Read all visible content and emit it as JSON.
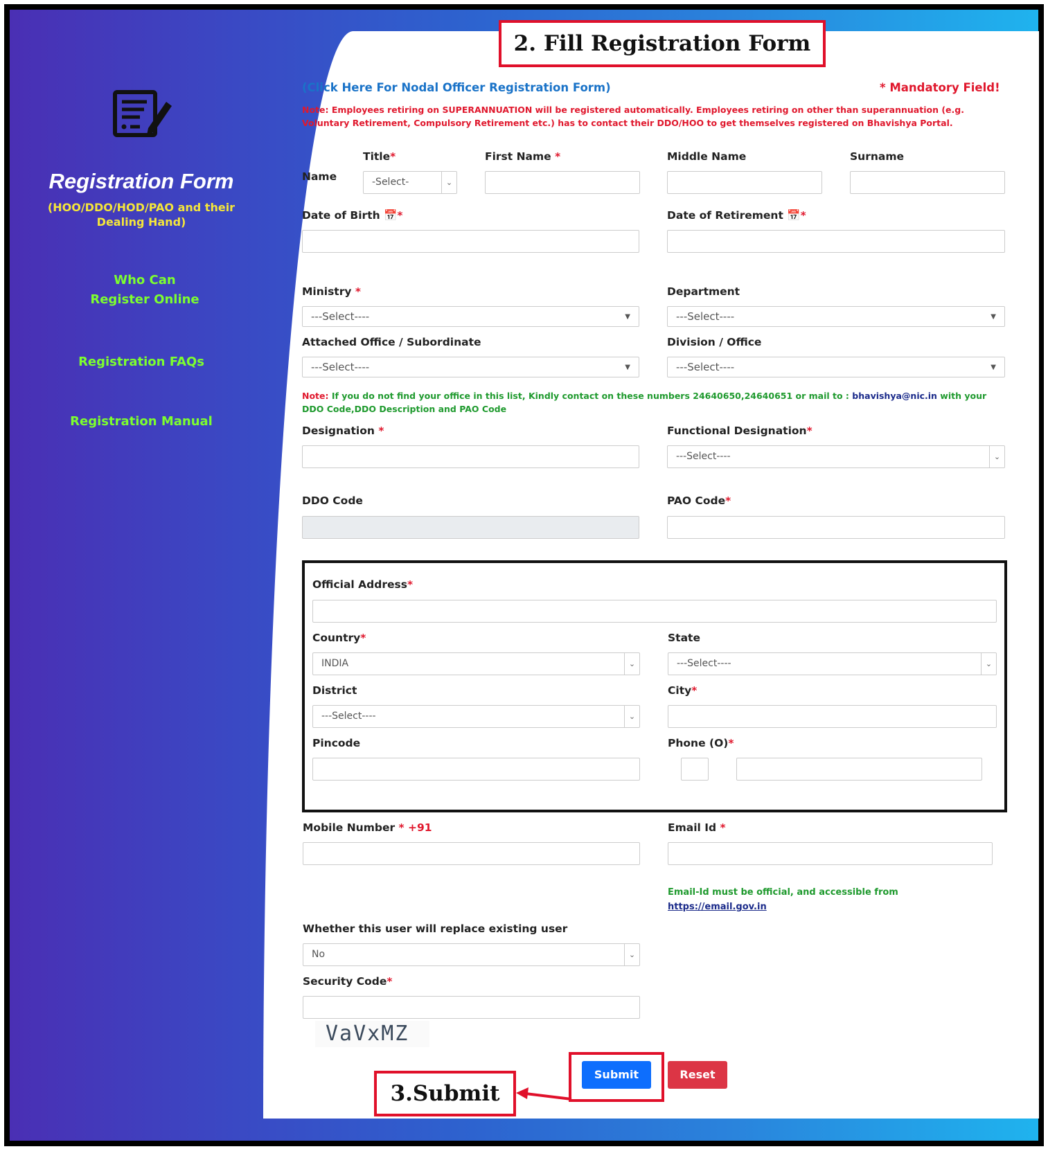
{
  "sidebar": {
    "title": "Registration Form",
    "subtitle": "(HOO/DDO/HOD/PAO and their Dealing Hand)",
    "links": [
      "Who Can Register Online",
      "Registration FAQs",
      "Registration Manual"
    ]
  },
  "annotations": {
    "step2": "2. Fill Registration Form",
    "step3": "3.Submit"
  },
  "header": {
    "nodal_link": "(Click Here For Nodal Officer Registration Form)",
    "mandatory": "* Mandatory Field!",
    "note_superannuation": "Note: Employees retiring on SUPERANNUATION will be registered automatically. Employees retiring on other than superannuation (e.g. Voluntary Retirement, Compulsory Retirement etc.) has to contact their DDO/HOO to get themselves registered on Bhavishya Portal."
  },
  "name_row": {
    "row_label": "Name",
    "title_label": "Title",
    "title_value": "-Select-",
    "first_label": "First Name",
    "middle_label": "Middle Name",
    "surname_label": "Surname"
  },
  "dates": {
    "dob_label": "Date of Birth",
    "dor_label": "Date of Retirement"
  },
  "org": {
    "ministry_label": "Ministry",
    "ministry_value": "---Select----",
    "department_label": "Department",
    "department_value": "---Select----",
    "attached_label": "Attached Office / Subordinate",
    "attached_value": "---Select----",
    "division_label": "Division / Office",
    "division_value": "---Select----",
    "note_prefix": "Note:",
    "note_text": " If you do not find your office in this list, Kindly contact on these numbers 24640650,24640651 or mail to : ",
    "note_email": "bhavishya@nic.in",
    "note_suffix": " with your DDO Code,DDO Description and PAO Code"
  },
  "designation": {
    "designation_label": "Designation",
    "functional_label": "Functional Designation",
    "functional_value": "---Select----",
    "ddo_label": "DDO Code",
    "pao_label": "PAO Code"
  },
  "address": {
    "official_label": "Official Address",
    "country_label": "Country",
    "country_value": "INDIA",
    "state_label": "State",
    "state_value": "---Select----",
    "district_label": "District",
    "district_value": "---Select----",
    "city_label": "City",
    "pincode_label": "Pincode",
    "phone_label": "Phone (O)"
  },
  "contact": {
    "mobile_label": "Mobile Number",
    "mobile_prefix": "+91",
    "email_label": "Email Id",
    "email_note": "Email-Id must be official, and accessible from",
    "email_link": "https://email.gov.in"
  },
  "replace": {
    "label": "Whether this user will replace existing user",
    "value": "No"
  },
  "security": {
    "label": "Security Code",
    "captcha": "VaVxMZ"
  },
  "buttons": {
    "submit": "Submit",
    "reset": "Reset"
  },
  "colors": {
    "submit_bg": "#0d6efd",
    "reset_bg": "#dc3545",
    "annotation_red": "#e0102a",
    "link_blue": "#1a73c8",
    "sidebar_green": "#7dff2e",
    "sidebar_yellow": "#f5e63a"
  }
}
